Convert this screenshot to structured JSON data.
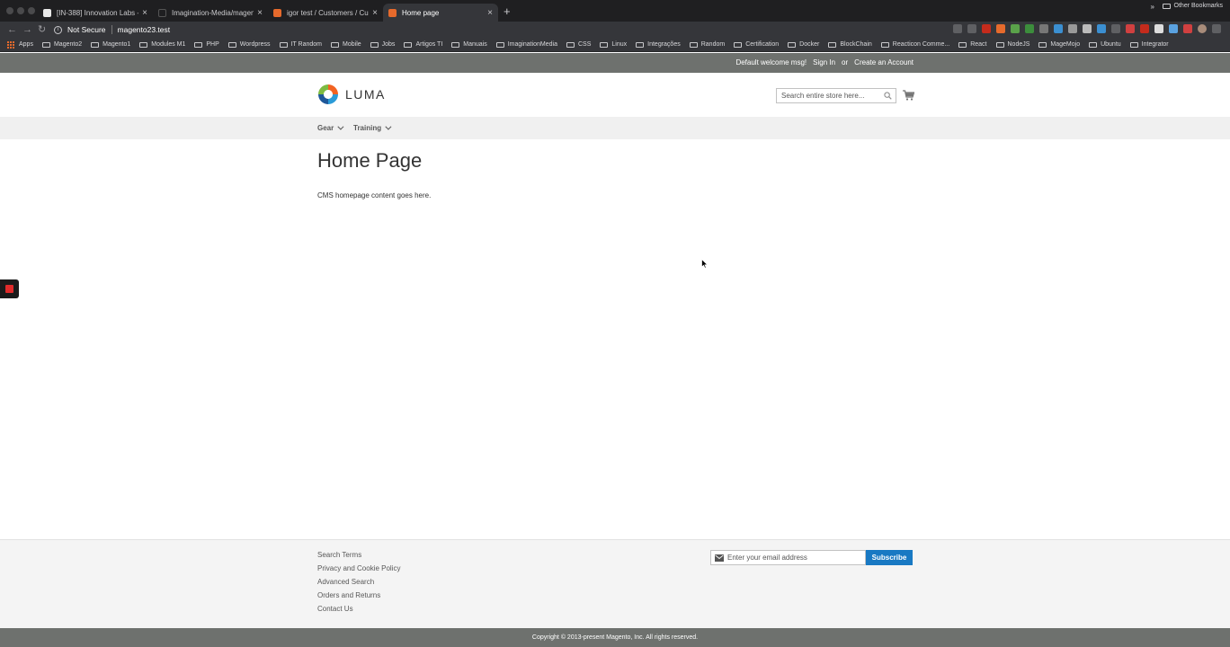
{
  "browser": {
    "tabs": [
      {
        "title": "[IN-388] Innovation Labs - Inn",
        "favicon_color": "#e8e8e8"
      },
      {
        "title": "Imagination-Media/magento2",
        "favicon_color": "#1f1f21"
      },
      {
        "title": "igor test / Customers / Custom",
        "favicon_color": "#e66a2c"
      },
      {
        "title": "Home page",
        "favicon_color": "#e66a2c"
      }
    ],
    "security_label": "Not Secure",
    "url": "magento23.test",
    "bookmarks": [
      "Apps",
      "Magento2",
      "Magento1",
      "Modules M1",
      "PHP",
      "Wordpress",
      "IT Random",
      "Mobile",
      "Jobs",
      "Artigos TI",
      "Manuais",
      "ImaginationMedia",
      "CSS",
      "Linux",
      "Integrações",
      "Random",
      "Certification",
      "Docker",
      "BlockChain",
      "Reacticon Comme...",
      "React",
      "NodeJS",
      "MageMojo",
      "Ubuntu",
      "Integrator"
    ],
    "other_bookmarks": "Other Bookmarks",
    "more_bookmarks": "»"
  },
  "panel": {
    "welcome": "Default welcome msg!",
    "sign_in": "Sign In",
    "or": "or",
    "create_account": "Create an Account"
  },
  "header": {
    "logo_text": "LUMA",
    "search_placeholder": "Search entire store here..."
  },
  "nav": {
    "items": [
      {
        "label": "Gear"
      },
      {
        "label": "Training"
      }
    ]
  },
  "main": {
    "title": "Home Page",
    "content": "CMS homepage content goes here."
  },
  "footer": {
    "links": [
      "Search Terms",
      "Privacy and Cookie Policy",
      "Advanced Search",
      "Orders and Returns",
      "Contact Us"
    ],
    "newsletter_placeholder": "Enter your email address",
    "subscribe_label": "Subscribe",
    "copyright": "Copyright © 2013-present Magento, Inc. All rights reserved."
  },
  "colors": {
    "accent": "#1979c3",
    "panel": "#6e716e"
  }
}
